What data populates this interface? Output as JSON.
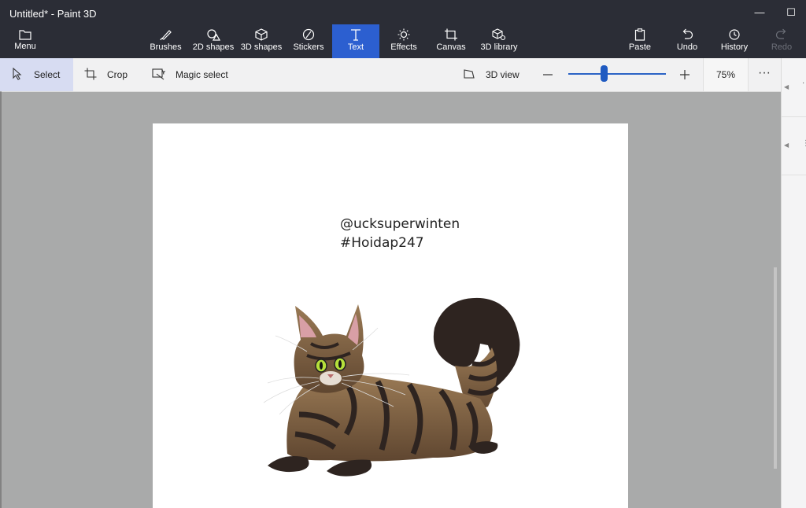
{
  "window": {
    "title": "Untitled* - Paint 3D"
  },
  "toolbar": {
    "menu": "Menu",
    "tools": [
      {
        "label": "Brushes",
        "icon": "brush-icon"
      },
      {
        "label": "2D shapes",
        "icon": "2d-shapes-icon"
      },
      {
        "label": "3D shapes",
        "icon": "3d-shapes-icon"
      },
      {
        "label": "Stickers",
        "icon": "stickers-icon"
      },
      {
        "label": "Text",
        "icon": "text-icon",
        "active": true
      },
      {
        "label": "Effects",
        "icon": "effects-icon"
      },
      {
        "label": "Canvas",
        "icon": "canvas-icon"
      },
      {
        "label": "3D library",
        "icon": "3d-library-icon"
      }
    ],
    "actions": [
      {
        "label": "Paste",
        "icon": "paste-icon"
      },
      {
        "label": "Undo",
        "icon": "undo-icon"
      },
      {
        "label": "History",
        "icon": "history-icon"
      },
      {
        "label": "Redo",
        "icon": "redo-icon",
        "disabled": true
      }
    ]
  },
  "subbar": {
    "select": "Select",
    "crop": "Crop",
    "magic_select": "Magic select",
    "view_3d": "3D view",
    "zoom_level": "75%",
    "more": "···"
  },
  "canvas": {
    "text_line1": "@ucksuperwinten",
    "text_line2": "#Hoidap247"
  },
  "colors": {
    "titlebar": "#2b2d36",
    "accent": "#2c5fd0",
    "canvas_bg": "#a9aaaa"
  }
}
